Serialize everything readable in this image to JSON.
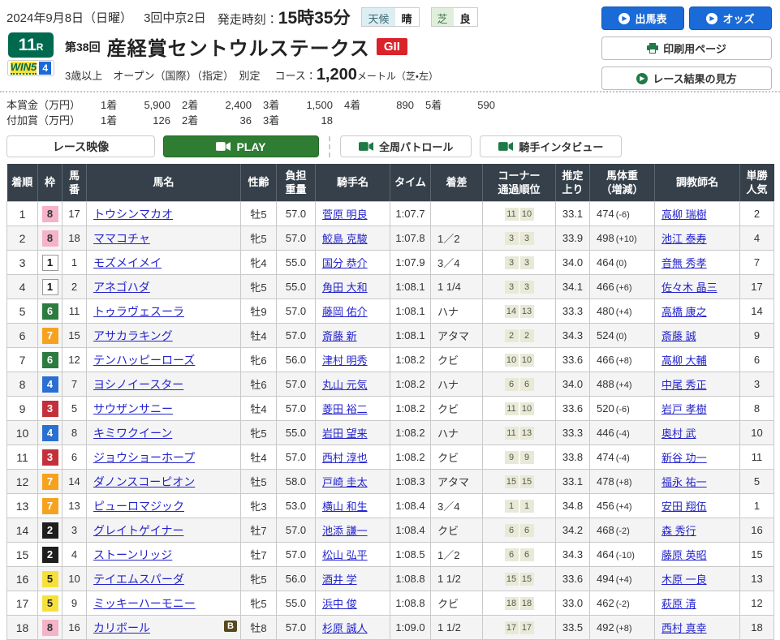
{
  "header": {
    "date_line": "2024年9月8日（日曜）",
    "meeting": "3回中京2日",
    "start_label": "発走時刻：",
    "start_time": "15時35分",
    "weather_label": "天候",
    "weather_value": "晴",
    "turf_label": "芝",
    "turf_value": "良",
    "buttons": {
      "entries": "出馬表",
      "odds": "オッズ",
      "print": "印刷用ページ",
      "guide": "レース結果の見方"
    }
  },
  "race": {
    "number": "11",
    "number_suffix": "R",
    "win5": "WIN5",
    "win5_num": "4",
    "edition": "第38回",
    "title": "産経賞セントウルステークス",
    "grade": "GII",
    "conditions": "3歳以上　オープン（国際）（指定）　別定",
    "course_label": "コース：",
    "course_value": "1,200",
    "course_unit": "メートル（芝・左）"
  },
  "prizes": {
    "main_label": "本賞金（万円）",
    "main": [
      {
        "r": "1着",
        "v": "5,900"
      },
      {
        "r": "2着",
        "v": "2,400"
      },
      {
        "r": "3着",
        "v": "1,500"
      },
      {
        "r": "4着",
        "v": "890"
      },
      {
        "r": "5着",
        "v": "590"
      }
    ],
    "added_label": "付加賞（万円）",
    "added": [
      {
        "r": "1着",
        "v": "126"
      },
      {
        "r": "2着",
        "v": "36"
      },
      {
        "r": "3着",
        "v": "18"
      }
    ]
  },
  "video": {
    "race_video": "レース映像",
    "play": "PLAY",
    "patrol": "全周パトロール",
    "interview": "騎手インタビュー"
  },
  "table": {
    "headers": [
      "着順",
      "枠",
      "馬\n番",
      "馬名",
      "性齢",
      "負担\n重量",
      "騎手名",
      "タイム",
      "着差",
      "コーナー\n通過順位",
      "推定\n上り",
      "馬体重\n（増減）",
      "調教師名",
      "単勝\n人気"
    ],
    "rows": [
      {
        "pos": "1",
        "waku": "8",
        "num": "17",
        "horse": "トウシンマカオ",
        "badge": "",
        "sexage": "牡5",
        "carry": "57.0",
        "jockey": "菅原 明良",
        "time": "1:07.7",
        "margin": "",
        "corners": [
          "11",
          "10"
        ],
        "last3f": "33.1",
        "body": "474",
        "diff": "(-6)",
        "trainer": "高柳 瑞樹",
        "fav": "2"
      },
      {
        "pos": "2",
        "waku": "8",
        "num": "18",
        "horse": "ママコチャ",
        "badge": "",
        "sexage": "牝5",
        "carry": "57.0",
        "jockey": "鮫島 克駿",
        "time": "1:07.8",
        "margin": "1／2",
        "corners": [
          "3",
          "3"
        ],
        "last3f": "33.9",
        "body": "498",
        "diff": "(+10)",
        "trainer": "池江 泰寿",
        "fav": "4"
      },
      {
        "pos": "3",
        "waku": "1",
        "num": "1",
        "horse": "モズメイメイ",
        "badge": "",
        "sexage": "牝4",
        "carry": "55.0",
        "jockey": "国分 恭介",
        "time": "1:07.9",
        "margin": "3／4",
        "corners": [
          "3",
          "3"
        ],
        "last3f": "34.0",
        "body": "464",
        "diff": "(0)",
        "trainer": "音無 秀孝",
        "fav": "7"
      },
      {
        "pos": "4",
        "waku": "1",
        "num": "2",
        "horse": "アネゴハダ",
        "badge": "",
        "sexage": "牝5",
        "carry": "55.0",
        "jockey": "角田 大和",
        "time": "1:08.1",
        "margin": "1 1/4",
        "corners": [
          "3",
          "3"
        ],
        "last3f": "34.1",
        "body": "466",
        "diff": "(+6)",
        "trainer": "佐々木 晶三",
        "fav": "17"
      },
      {
        "pos": "5",
        "waku": "6",
        "num": "11",
        "horse": "トゥラヴェスーラ",
        "badge": "",
        "sexage": "牡9",
        "carry": "57.0",
        "jockey": "藤岡 佑介",
        "time": "1:08.1",
        "margin": "ハナ",
        "corners": [
          "14",
          "13"
        ],
        "last3f": "33.3",
        "body": "480",
        "diff": "(+4)",
        "trainer": "高橋 康之",
        "fav": "14"
      },
      {
        "pos": "6",
        "waku": "7",
        "num": "15",
        "horse": "アサカラキング",
        "badge": "",
        "sexage": "牡4",
        "carry": "57.0",
        "jockey": "斎藤 新",
        "time": "1:08.1",
        "margin": "アタマ",
        "corners": [
          "2",
          "2"
        ],
        "last3f": "34.3",
        "body": "524",
        "diff": "(0)",
        "trainer": "斎藤 誠",
        "fav": "9"
      },
      {
        "pos": "7",
        "waku": "6",
        "num": "12",
        "horse": "テンハッピーローズ",
        "badge": "",
        "sexage": "牝6",
        "carry": "56.0",
        "jockey": "津村 明秀",
        "time": "1:08.2",
        "margin": "クビ",
        "corners": [
          "10",
          "10"
        ],
        "last3f": "33.6",
        "body": "466",
        "diff": "(+8)",
        "trainer": "高柳 大輔",
        "fav": "6"
      },
      {
        "pos": "8",
        "waku": "4",
        "num": "7",
        "horse": "ヨシノイースター",
        "badge": "",
        "sexage": "牡6",
        "carry": "57.0",
        "jockey": "丸山 元気",
        "time": "1:08.2",
        "margin": "ハナ",
        "corners": [
          "6",
          "6"
        ],
        "last3f": "34.0",
        "body": "488",
        "diff": "(+4)",
        "trainer": "中尾 秀正",
        "fav": "3"
      },
      {
        "pos": "9",
        "waku": "3",
        "num": "5",
        "horse": "サウザンサニー",
        "badge": "",
        "sexage": "牡4",
        "carry": "57.0",
        "jockey": "菱田 裕二",
        "time": "1:08.2",
        "margin": "クビ",
        "corners": [
          "11",
          "10"
        ],
        "last3f": "33.6",
        "body": "520",
        "diff": "(-6)",
        "trainer": "岩戸 孝樹",
        "fav": "8"
      },
      {
        "pos": "10",
        "waku": "4",
        "num": "8",
        "horse": "キミワクイーン",
        "badge": "",
        "sexage": "牝5",
        "carry": "55.0",
        "jockey": "岩田 望来",
        "time": "1:08.2",
        "margin": "ハナ",
        "corners": [
          "11",
          "13"
        ],
        "last3f": "33.3",
        "body": "446",
        "diff": "(-4)",
        "trainer": "奥村 武",
        "fav": "10"
      },
      {
        "pos": "11",
        "waku": "3",
        "num": "6",
        "horse": "ジョウショーホープ",
        "badge": "",
        "sexage": "牡4",
        "carry": "57.0",
        "jockey": "西村 淳也",
        "time": "1:08.2",
        "margin": "クビ",
        "corners": [
          "9",
          "9"
        ],
        "last3f": "33.8",
        "body": "474",
        "diff": "(-4)",
        "trainer": "新谷 功一",
        "fav": "11"
      },
      {
        "pos": "12",
        "waku": "7",
        "num": "14",
        "horse": "ダノンスコーピオン",
        "badge": "",
        "sexage": "牡5",
        "carry": "58.0",
        "jockey": "戸崎 圭太",
        "time": "1:08.3",
        "margin": "アタマ",
        "corners": [
          "15",
          "15"
        ],
        "last3f": "33.1",
        "body": "478",
        "diff": "(+8)",
        "trainer": "福永 祐一",
        "fav": "5"
      },
      {
        "pos": "13",
        "waku": "7",
        "num": "13",
        "horse": "ピューロマジック",
        "badge": "",
        "sexage": "牝3",
        "carry": "53.0",
        "jockey": "横山 和生",
        "time": "1:08.4",
        "margin": "3／4",
        "corners": [
          "1",
          "1"
        ],
        "last3f": "34.8",
        "body": "456",
        "diff": "(+4)",
        "trainer": "安田 翔伍",
        "fav": "1"
      },
      {
        "pos": "14",
        "waku": "2",
        "num": "3",
        "horse": "グレイトゲイナー",
        "badge": "",
        "sexage": "牡7",
        "carry": "57.0",
        "jockey": "池添 謙一",
        "time": "1:08.4",
        "margin": "クビ",
        "corners": [
          "6",
          "6"
        ],
        "last3f": "34.2",
        "body": "468",
        "diff": "(-2)",
        "trainer": "森 秀行",
        "fav": "16"
      },
      {
        "pos": "15",
        "waku": "2",
        "num": "4",
        "horse": "ストーンリッジ",
        "badge": "",
        "sexage": "牡7",
        "carry": "57.0",
        "jockey": "松山 弘平",
        "time": "1:08.5",
        "margin": "1／2",
        "corners": [
          "6",
          "6"
        ],
        "last3f": "34.3",
        "body": "464",
        "diff": "(-10)",
        "trainer": "藤原 英昭",
        "fav": "15"
      },
      {
        "pos": "16",
        "waku": "5",
        "num": "10",
        "horse": "テイエムスパーダ",
        "badge": "",
        "sexage": "牝5",
        "carry": "56.0",
        "jockey": "酒井 学",
        "time": "1:08.8",
        "margin": "1 1/2",
        "corners": [
          "15",
          "15"
        ],
        "last3f": "33.6",
        "body": "494",
        "diff": "(+4)",
        "trainer": "木原 一良",
        "fav": "13"
      },
      {
        "pos": "17",
        "waku": "5",
        "num": "9",
        "horse": "ミッキーハーモニー",
        "badge": "",
        "sexage": "牝5",
        "carry": "55.0",
        "jockey": "浜中 俊",
        "time": "1:08.8",
        "margin": "クビ",
        "corners": [
          "18",
          "18"
        ],
        "last3f": "33.0",
        "body": "462",
        "diff": "(-2)",
        "trainer": "萩原 清",
        "fav": "12"
      },
      {
        "pos": "18",
        "waku": "8",
        "num": "16",
        "horse": "カリボール",
        "badge": "B",
        "sexage": "牡8",
        "carry": "57.0",
        "jockey": "杉原 誠人",
        "time": "1:09.0",
        "margin": "1 1/2",
        "corners": [
          "17",
          "17"
        ],
        "last3f": "33.5",
        "body": "492",
        "diff": "(+8)",
        "trainer": "西村 真幸",
        "fav": "18"
      }
    ]
  }
}
